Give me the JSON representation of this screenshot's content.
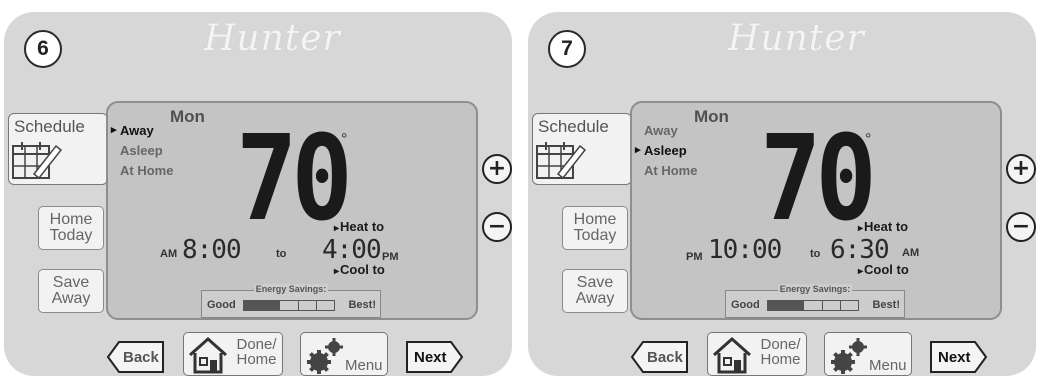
{
  "panels": [
    {
      "step": "6",
      "logo": "Hunter",
      "schedule_label": "Schedule",
      "home_today_label": "Home Today",
      "save_away_label": "Save Away",
      "day": "Mon",
      "modes": [
        "Away",
        "Asleep",
        "At Home"
      ],
      "active_mode": "Away",
      "temperature": "70",
      "degree": "°",
      "heat_to": "Heat to",
      "cool_to": "Cool to",
      "start_ampm": "AM",
      "start_time": "8:00",
      "to": "to",
      "end_time": "4:00",
      "end_ampm": "PM",
      "energy_label": "Energy Savings:",
      "energy_good": "Good",
      "energy_best": "Best!",
      "energy_level": 0.4,
      "plus": "+",
      "minus": "−",
      "back_label": "Back",
      "done_label": "Done/ Home",
      "menu_label": "Menu",
      "next_label": "Next"
    },
    {
      "step": "7",
      "logo": "Hunter",
      "schedule_label": "Schedule",
      "home_today_label": "Home Today",
      "save_away_label": "Save Away",
      "day": "Mon",
      "modes": [
        "Away",
        "Asleep",
        "At Home"
      ],
      "active_mode": "Asleep",
      "temperature": "70",
      "degree": "°",
      "heat_to": "Heat to",
      "cool_to": "Cool to",
      "start_ampm": "PM",
      "start_time": "10:00",
      "to": "to",
      "end_time": "6:30",
      "end_ampm": "AM",
      "energy_label": "Energy Savings:",
      "energy_good": "Good",
      "energy_best": "Best!",
      "energy_level": 0.4,
      "plus": "+",
      "minus": "−",
      "back_label": "Back",
      "done_label": "Done/ Home",
      "menu_label": "Menu",
      "next_label": "Next"
    }
  ]
}
